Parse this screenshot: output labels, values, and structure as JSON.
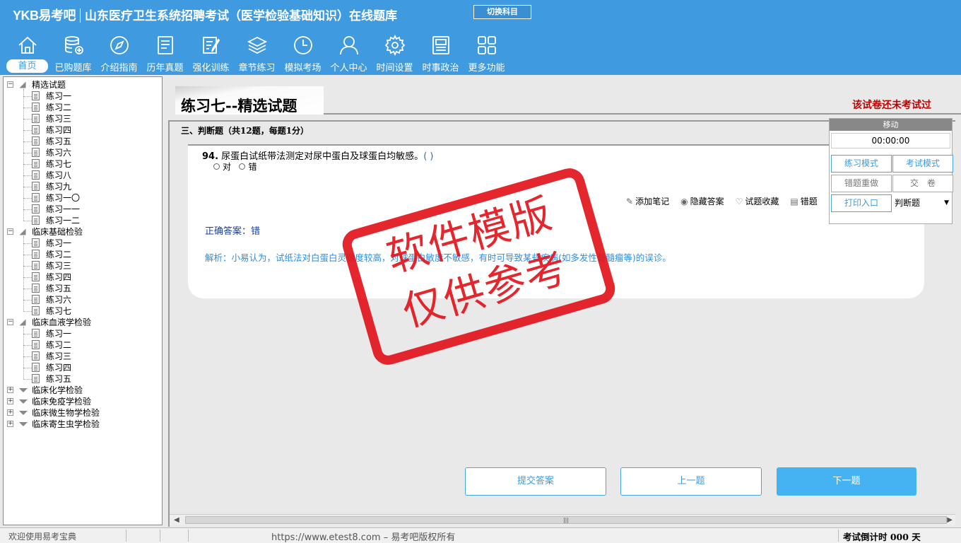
{
  "header": {
    "logo": "YKB易考吧",
    "title": "山东医疗卫生系统招聘考试（医学检验基础知识）在线题库",
    "switch_label": "切换科目"
  },
  "nav": [
    {
      "label": "首页",
      "icon": "home-icon"
    },
    {
      "label": "已购题库",
      "icon": "database-icon"
    },
    {
      "label": "介绍指南",
      "icon": "compass-icon"
    },
    {
      "label": "历年真题",
      "icon": "list-icon"
    },
    {
      "label": "强化训练",
      "icon": "edit-icon"
    },
    {
      "label": "章节练习",
      "icon": "layers-icon"
    },
    {
      "label": "模拟考场",
      "icon": "clock-icon"
    },
    {
      "label": "个人中心",
      "icon": "user-icon"
    },
    {
      "label": "时间设置",
      "icon": "gear-icon"
    },
    {
      "label": "时事政治",
      "icon": "news-icon"
    },
    {
      "label": "更多功能",
      "icon": "grid-icon"
    }
  ],
  "tree": [
    {
      "label": "精选试题",
      "expanded": true,
      "children": [
        "练习一",
        "练习二",
        "练习三",
        "练习四",
        "练习五",
        "练习六",
        "练习七",
        "练习八",
        "练习九",
        "练习一〇",
        "练习一一",
        "练习一二"
      ]
    },
    {
      "label": "临床基础检验",
      "expanded": true,
      "children": [
        "练习一",
        "练习二",
        "练习三",
        "练习四",
        "练习五",
        "练习六",
        "练习七"
      ]
    },
    {
      "label": "临床血液学检验",
      "expanded": true,
      "children": [
        "练习一",
        "练习二",
        "练习三",
        "练习四",
        "练习五"
      ]
    },
    {
      "label": "临床化学检验",
      "expanded": false,
      "children": []
    },
    {
      "label": "临床免疫学检验",
      "expanded": false,
      "children": []
    },
    {
      "label": "临床微生物学检验",
      "expanded": false,
      "children": []
    },
    {
      "label": "临床寄生虫学检验",
      "expanded": false,
      "children": []
    }
  ],
  "main": {
    "page_title": "练习七--精选试题",
    "exam_status": "该试卷还未考试过",
    "section_head": "三、判断题（共12题，每题1分）",
    "question": {
      "number": "94.",
      "text": "尿蛋白试纸带法测定对尿中蛋白及球蛋白均敏感。",
      "paren": "( )",
      "options": [
        "对",
        "错"
      ]
    },
    "tools": [
      {
        "icon": "pencil-icon",
        "glyph": "✎",
        "label": "添加笔记"
      },
      {
        "icon": "eye-icon",
        "glyph": "◉",
        "label": "隐藏答案"
      },
      {
        "icon": "heart-icon",
        "glyph": "♡",
        "label": "试题收藏"
      },
      {
        "icon": "book-icon",
        "glyph": "▤",
        "label": "错题"
      }
    ],
    "answer": "正确答案：错",
    "analysis": "解析：小易认为，试纸法对白蛋白灵敏度较高，对球蛋白敏度不敏感，有时可导致某些疾病(如多发性骨髓瘤等)的误诊。",
    "buttons": {
      "submit": "提交答案",
      "prev": "上一题",
      "next": "下一题"
    }
  },
  "panel": {
    "head": "移动",
    "timer": "00:00:00",
    "practice_mode": "练习模式",
    "exam_mode": "考试模式",
    "redo_wrong": "错题重做",
    "submit_paper": "交　卷",
    "print": "打印入口",
    "type_select": "判断题"
  },
  "watermark": {
    "line1": "软件模版",
    "line2": "仅供参考"
  },
  "status": {
    "welcome": "欢迎使用易考宝典",
    "copyright": "https://www.etest8.com – 易考吧版权所有",
    "countdown": "考试倒计时 000 天"
  },
  "colors": {
    "brand": "#3f9ae0",
    "status_red": "#c00000",
    "stamp_red": "#e2141c"
  }
}
